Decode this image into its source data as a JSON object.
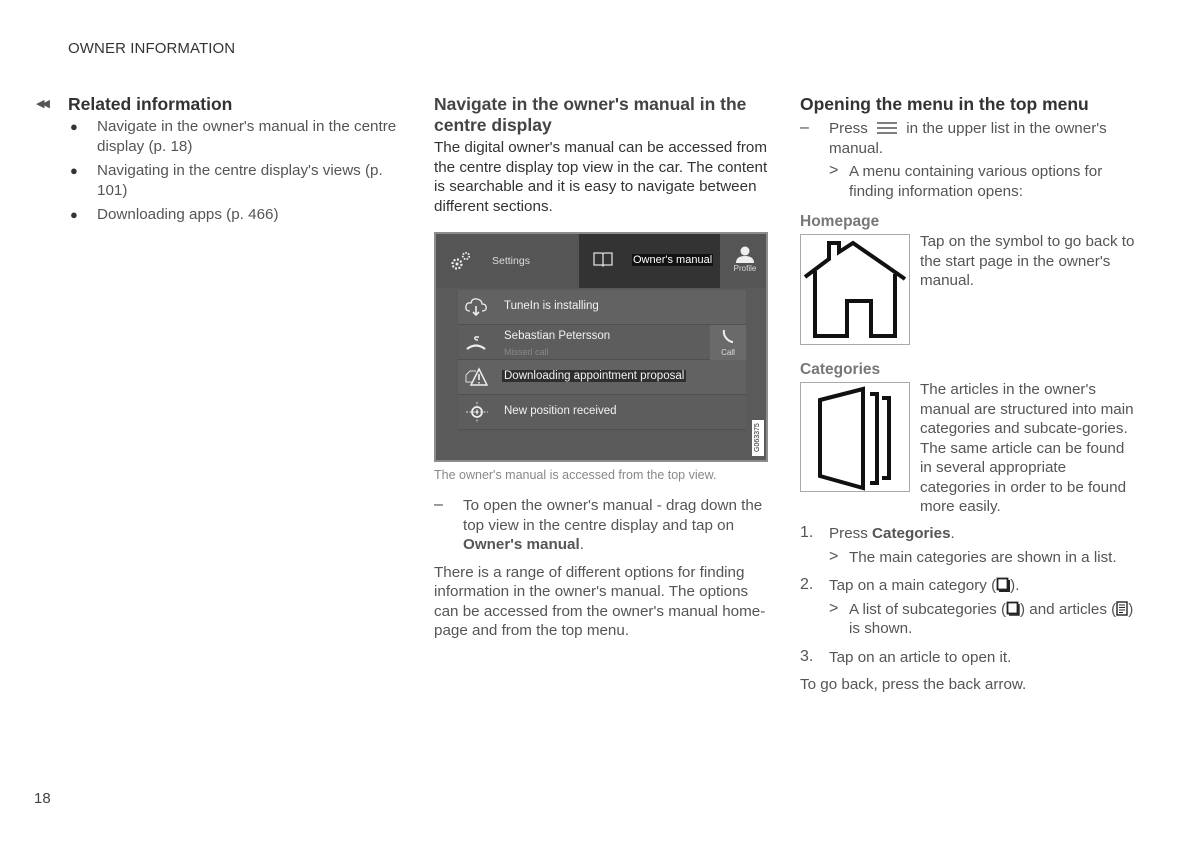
{
  "header": {
    "running_head": "OWNER INFORMATION"
  },
  "footer": {
    "page_number": "18"
  },
  "related": {
    "back_icon": "double-left-arrow-icon",
    "title": "Related information",
    "items": [
      {
        "text": "Navigate in the owner's manual in the centre display (p. 18)"
      },
      {
        "text": "Navigating in the centre display's views (p. 101)"
      },
      {
        "text": "Downloading apps (p. 466)"
      }
    ]
  },
  "navigate": {
    "title": "Navigate in the owner's manual in the centre display",
    "intro": "The digital owner's manual can be accessed from the centre display top view in the car. The content is searchable and it is easy to navigate between different sections.",
    "screen": {
      "tabs": {
        "settings": "Settings",
        "owners_manual": "Owner's manual",
        "profile": "Profile"
      },
      "notifications": [
        {
          "icon": "cloud-download-icon",
          "text": "TuneIn is installing"
        },
        {
          "icon": "missed-call-icon",
          "text": "Sebastian Petersson",
          "subtext": "Missed call",
          "action": "Call"
        },
        {
          "icon": "warning-icon",
          "text": "Downloading appointment proposal"
        },
        {
          "icon": "position-icon",
          "text": "New position received"
        }
      ],
      "image_code": "G063375"
    },
    "caption": "The owner's manual is accessed from the top view.",
    "step_prefix": "To open the owner's manual - drag down the top view in the centre display and tap on ",
    "step_bold": "Owner's manual",
    "step_suffix": ".",
    "outro": "There is a range of different options for finding information in the owner's manual. The options can be accessed from the owner's manual home-page and from the top menu."
  },
  "top_menu": {
    "title": "Opening the menu in the top menu",
    "step_press": "Press",
    "step_rest": "in the upper list in the owner's manual.",
    "result": "A menu containing various options for finding information opens:",
    "homepage": {
      "title": "Homepage",
      "icon": "house-icon",
      "text": "Tap on the symbol to go back to the start page in the owner's manual."
    },
    "categories": {
      "title": "Categories",
      "icon": "categories-icon",
      "text": "The articles in the owner's manual are structured into main categories and subcate-gories. The same article can be found in several appropriate categories in order to be found more easily."
    },
    "steps": [
      {
        "num": "1.",
        "pre": "Press ",
        "bold": "Categories",
        "post": ".",
        "result": "The main categories are shown in a list."
      },
      {
        "num": "2.",
        "pre": "Tap on a main category (",
        "post": ").",
        "result_pre": "A list of subcategories (",
        "result_mid": ") and articles (",
        "result_post": ") is shown."
      },
      {
        "num": "3.",
        "pre": "Tap on an article to open it."
      }
    ],
    "back_note": "To go back, press the back arrow."
  }
}
